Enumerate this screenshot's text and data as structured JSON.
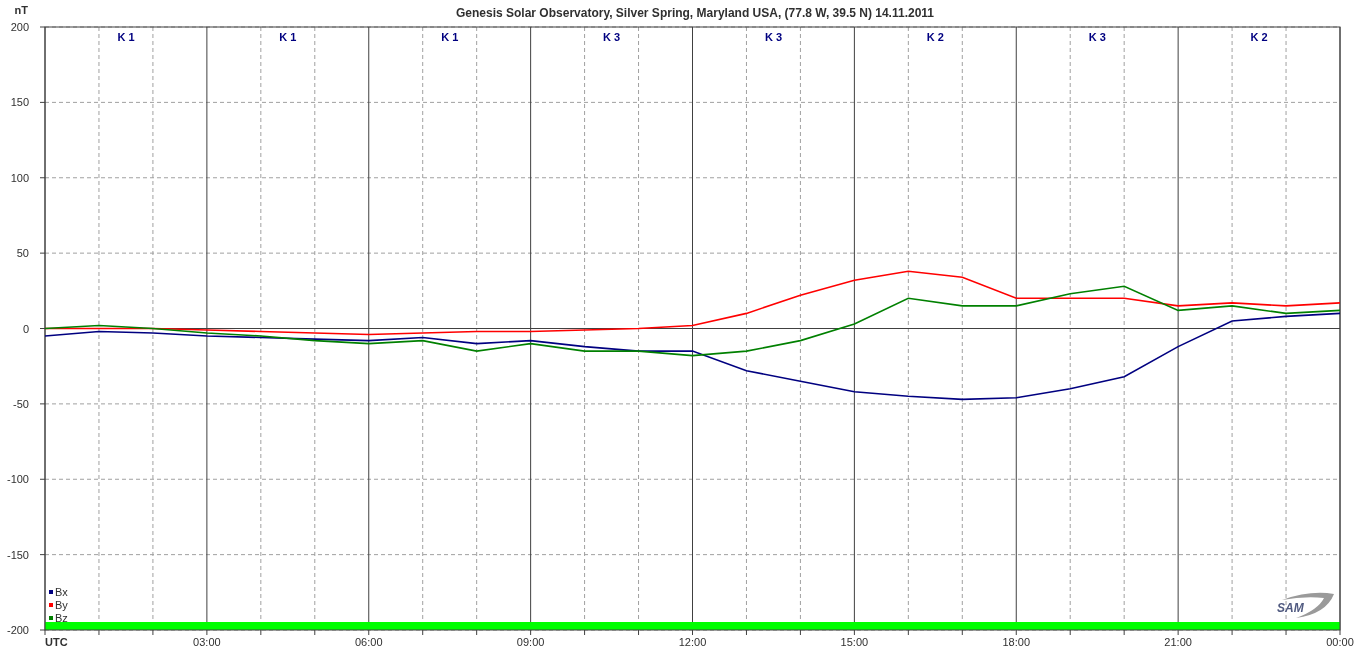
{
  "chart_data": {
    "type": "line",
    "title": "Genesis Solar Observatory, Silver Spring, Maryland USA, (77.8 W, 39.5 N)  14.11.2011",
    "ylabel": "nT",
    "x": [
      0,
      1,
      2,
      3,
      4,
      5,
      6,
      7,
      8,
      9,
      10,
      11,
      12,
      13,
      14,
      15,
      16,
      17,
      18,
      19,
      20,
      21,
      22,
      23,
      24
    ],
    "series": [
      {
        "name": "Bx",
        "color": "#000080",
        "values": [
          -5,
          -2,
          -3,
          -5,
          -6,
          -7,
          -8,
          -6,
          -10,
          -8,
          -12,
          -15,
          -15,
          -28,
          -35,
          -42,
          -45,
          -47,
          -46,
          -40,
          -32,
          -12,
          5,
          8,
          10
        ]
      },
      {
        "name": "By",
        "color": "#ff0000",
        "values": [
          0,
          0,
          0,
          -1,
          -2,
          -3,
          -4,
          -3,
          -2,
          -2,
          -1,
          0,
          2,
          10,
          22,
          32,
          38,
          34,
          20,
          20,
          20,
          15,
          17,
          15,
          17
        ]
      },
      {
        "name": "Bz",
        "color": "#008000",
        "values": [
          0,
          2,
          0,
          -3,
          -5,
          -8,
          -10,
          -8,
          -15,
          -10,
          -15,
          -15,
          -18,
          -15,
          -8,
          3,
          20,
          15,
          15,
          23,
          28,
          12,
          15,
          10,
          12
        ]
      }
    ],
    "xlim": [
      0,
      24
    ],
    "ylim": [
      -200,
      200
    ],
    "xticks": [
      {
        "value": 0,
        "label": "UTC"
      },
      {
        "value": 3,
        "label": "03:00"
      },
      {
        "value": 6,
        "label": "06:00"
      },
      {
        "value": 9,
        "label": "09:00"
      },
      {
        "value": 12,
        "label": "12:00"
      },
      {
        "value": 15,
        "label": "15:00"
      },
      {
        "value": 18,
        "label": "18:00"
      },
      {
        "value": 21,
        "label": "21:00"
      },
      {
        "value": 24,
        "label": "00:00"
      }
    ],
    "yticks": [
      -200,
      -150,
      -100,
      -50,
      0,
      50,
      100,
      150,
      200
    ],
    "grid": true,
    "legend": "lower left",
    "annotations": [
      "K 1",
      "K 1",
      "K 1",
      "K 3",
      "K 3",
      "K 2",
      "K 3",
      "K 2"
    ]
  },
  "logo": "SAM"
}
